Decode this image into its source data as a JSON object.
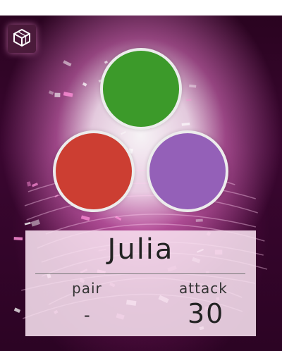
{
  "player": {
    "name": "Julia",
    "pair_label": "pair",
    "pair_value": "-",
    "attack_label": "attack",
    "attack_value": "30"
  },
  "orbs": [
    {
      "color": "#3c9a2a"
    },
    {
      "color": "#cc3e32"
    },
    {
      "color": "#9460b8"
    }
  ],
  "icons": {
    "menu": "cube-icon"
  },
  "colors": {
    "glow": "#ff9adc",
    "background": "#2a0420"
  }
}
